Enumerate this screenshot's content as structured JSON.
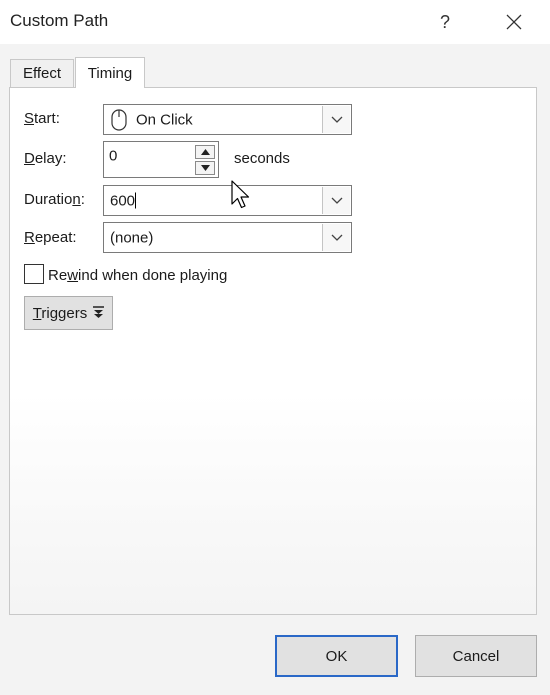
{
  "dialog": {
    "title": "Custom Path",
    "help_glyph": "?",
    "close_icon": "close-icon"
  },
  "tabs": [
    {
      "label": "Effect",
      "active": false
    },
    {
      "label": "Timing",
      "active": true
    }
  ],
  "timing": {
    "start": {
      "label_pre": "",
      "label_key": "S",
      "label_post": "tart:",
      "value": "On Click",
      "icon": "mouse-icon"
    },
    "delay": {
      "label_pre": "",
      "label_key": "D",
      "label_post": "elay:",
      "value": "0",
      "unit": "seconds"
    },
    "duration": {
      "label_pre": "Duratio",
      "label_key": "n",
      "label_post": ":",
      "value": "600"
    },
    "repeat": {
      "label_pre": "",
      "label_key": "R",
      "label_post": "epeat:",
      "value": "(none)"
    },
    "rewind": {
      "label_pre": "Re",
      "label_key": "w",
      "label_post": "ind when done playing",
      "checked": false
    },
    "triggers": {
      "label_pre": "",
      "label_key": "T",
      "label_post": "riggers",
      "icon": "double-chevron-down-icon"
    }
  },
  "buttons": {
    "ok": "OK",
    "cancel": "Cancel"
  }
}
